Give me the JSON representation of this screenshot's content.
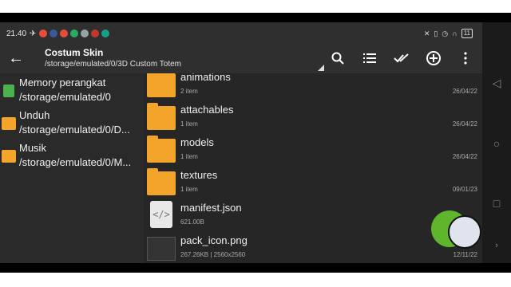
{
  "status": {
    "time": "21.40",
    "battery": "11"
  },
  "toolbar": {
    "title": "Costum Skin",
    "path": "/storage/emulated/0/3D Custom Totem"
  },
  "locations": [
    {
      "name": "Memory perangkat",
      "path": "/storage/emulated/0",
      "icon": "phone-icon",
      "color": "#4caf50"
    },
    {
      "name": "Unduh",
      "path": "/storage/emulated/0/D...",
      "icon": "download-folder-icon",
      "color": "#f3a52b"
    },
    {
      "name": "Musik",
      "path": "/storage/emulated/0/M...",
      "icon": "music-folder-icon",
      "color": "#f3a52b"
    }
  ],
  "files": [
    {
      "name": "animations",
      "meta": "2 item",
      "date": "26/04/22",
      "type": "folder"
    },
    {
      "name": "attachables",
      "meta": "1 item",
      "date": "26/04/22",
      "type": "folder"
    },
    {
      "name": "models",
      "meta": "1 item",
      "date": "26/04/22",
      "type": "folder"
    },
    {
      "name": "textures",
      "meta": "1 item",
      "date": "09/01/23",
      "type": "folder"
    },
    {
      "name": "manifest.json",
      "meta": "621.00B",
      "date": "",
      "type": "json"
    },
    {
      "name": "pack_icon.png",
      "meta": "267.26KB  |  2560x2560",
      "date": "12/11/22",
      "type": "image"
    }
  ],
  "colors": {
    "accent": "#5fb62c",
    "folder": "#f3a52b"
  }
}
